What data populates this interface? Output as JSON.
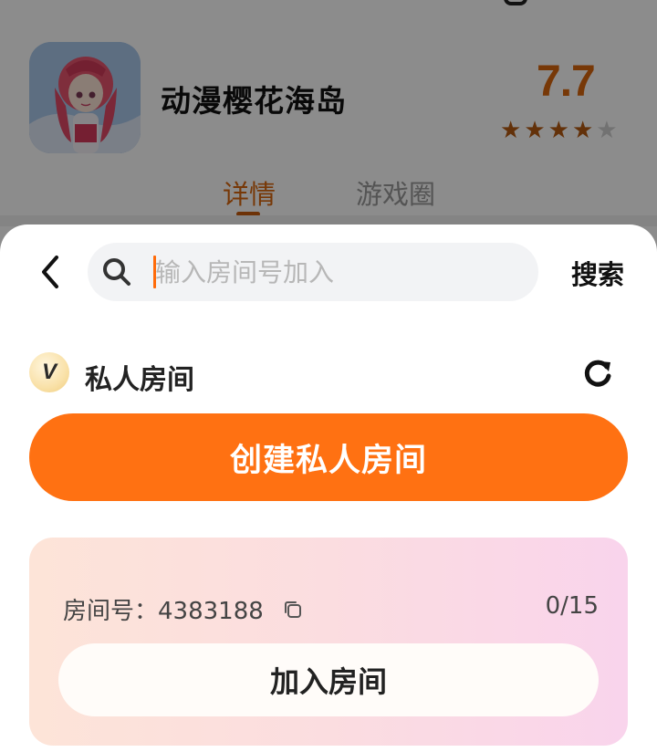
{
  "app": {
    "name": "动漫樱花海岛",
    "rating": "7.7",
    "stars": 4,
    "tabs": [
      {
        "label": "详情",
        "active": true
      },
      {
        "label": "游戏圈",
        "active": false
      }
    ]
  },
  "search": {
    "placeholder": "输入房间号加入",
    "button_label": "搜索"
  },
  "section": {
    "badge_letter": "V",
    "title": "私人房间"
  },
  "create_button_label": "创建私人房间",
  "room": {
    "id_label": "房间号：4383188",
    "count": "0/15",
    "join_label": "加入房间"
  },
  "colors": {
    "accent": "#ff7112",
    "rating": "#d9670d"
  },
  "icons": [
    "back-arrow-icon",
    "search-icon",
    "refresh-icon",
    "copy-icon",
    "star-icon"
  ]
}
